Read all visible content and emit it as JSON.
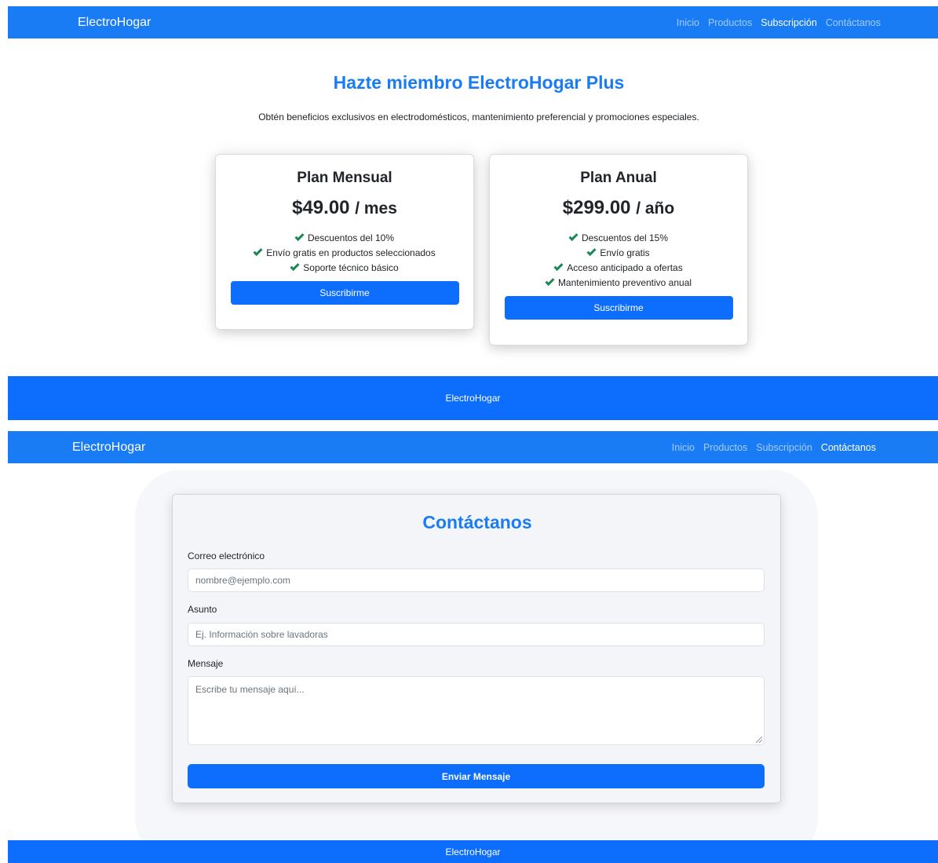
{
  "screen1": {
    "brand": "ElectroHogar",
    "nav": [
      "Inicio",
      "Productos",
      "Subscripción",
      "Contáctanos"
    ],
    "title": "Hazte miembro ElectroHogar Plus",
    "subtitle": "Obtén beneficios exclusivos en electrodomésticos, mantenimiento preferencial y promociones especiales.",
    "plans": [
      {
        "name": "Plan Mensual",
        "price": "$49.00",
        "period": "/ mes",
        "features": [
          "Descuentos del 10%",
          "Envío gratis en productos seleccionados",
          "Soporte técnico básico"
        ],
        "button": "Suscribirme"
      },
      {
        "name": "Plan Anual",
        "price": "$299.00",
        "period": "/ año",
        "features": [
          "Descuentos del 15%",
          "Envío gratis",
          "Acceso anticipado a ofertas",
          "Mantenimiento preventivo anual"
        ],
        "button": "Suscribirme"
      }
    ],
    "footer": "ElectroHogar"
  },
  "screen2": {
    "brand": "ElectroHogar",
    "nav": [
      "Inicio",
      "Productos",
      "Subscripción",
      "Contáctanos"
    ],
    "title": "Contáctanos",
    "email_label": "Correo electrónico",
    "email_placeholder": "nombre@ejemplo.com",
    "subject_label": "Asunto",
    "subject_placeholder": "Ej. Información sobre lavadoras",
    "message_label": "Mensaje",
    "message_placeholder": "Escribe tu mensaje aquí...",
    "send_button": "Enviar Mensaje",
    "footer": "ElectroHogar"
  },
  "colors": {
    "primary": "#0d6efd",
    "navbar": "#1a7cf5",
    "check": "#198754"
  }
}
